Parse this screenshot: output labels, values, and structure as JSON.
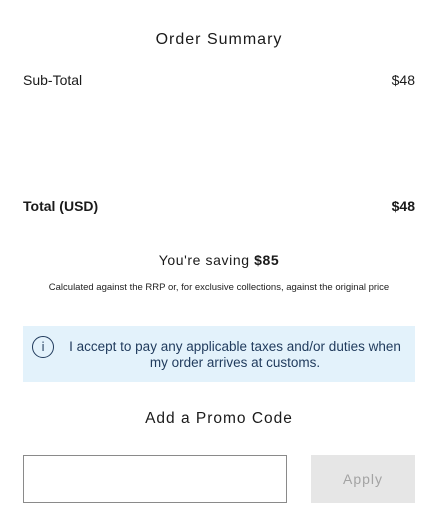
{
  "order_summary": {
    "title": "Order Summary",
    "subtotal": {
      "label": "Sub-Total",
      "value": "$48"
    },
    "total": {
      "label": "Total (USD)",
      "value": "$48"
    }
  },
  "savings": {
    "prefix": "You're saving ",
    "amount": "$85",
    "note": "Calculated against the RRP or, for exclusive collections, against the original price"
  },
  "customs_notice": {
    "icon": "info-icon",
    "icon_glyph": "i",
    "text": "I accept to pay any applicable taxes and/or duties when my order arrives at customs.",
    "background_color": "#e3f2fb",
    "text_color": "#1f3a5c"
  },
  "promo": {
    "title": "Add a Promo Code",
    "input_value": "",
    "input_placeholder": "",
    "apply_label": "Apply",
    "apply_disabled": true
  }
}
